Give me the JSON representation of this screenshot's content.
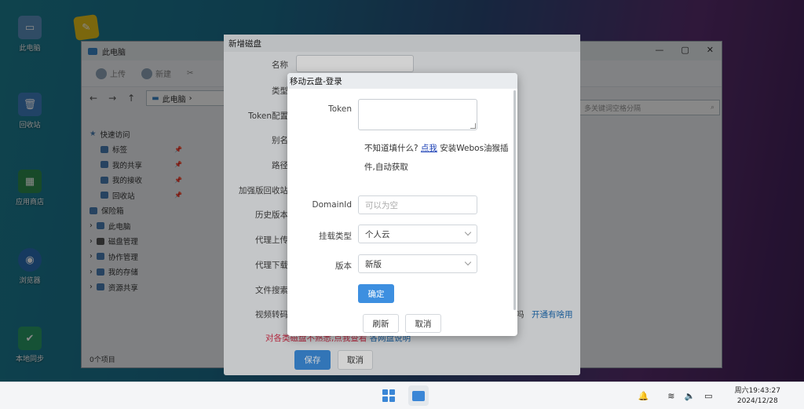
{
  "desktop": {
    "icons": [
      {
        "label": "此电脑"
      },
      {
        "label": "回收站"
      },
      {
        "label": "应用商店"
      },
      {
        "label": "浏览器"
      },
      {
        "label": "本地同步"
      }
    ]
  },
  "explorer": {
    "title": "此电脑",
    "toolbar": {
      "upload": "上传",
      "new": "新建"
    },
    "breadcrumb": "此电脑",
    "search_placeholder": "多关键词空格分隔",
    "sidebar": [
      {
        "label": "快速访问"
      },
      {
        "label": "标签"
      },
      {
        "label": "我的共享"
      },
      {
        "label": "我的接收"
      },
      {
        "label": "回收站"
      },
      {
        "label": "保险箱"
      },
      {
        "label": "此电脑"
      },
      {
        "label": "磁盘管理"
      },
      {
        "label": "协作管理"
      },
      {
        "label": "我的存储"
      },
      {
        "label": "资源共享"
      }
    ],
    "status": "0个项目"
  },
  "newdisk": {
    "title": "新增磁盘",
    "fields": {
      "name": "名称",
      "type": "类型",
      "token": "Token配置",
      "alias": "别名",
      "path": "路径",
      "recycle": "加强版回收站",
      "history": "历史版本",
      "proxy_upload": "代理上传",
      "proxy_download": "代理下载",
      "file_search": "文件搜索",
      "video": "视频转码"
    },
    "right_link": "开通有啥用",
    "right_text": "吗",
    "warning": "对各类磁盘不熟悉,点我查看",
    "warning_link": "各网盘说明",
    "save": "保存",
    "cancel": "取消"
  },
  "login": {
    "title": "移动云盘-登录",
    "token_label": "Token",
    "hint_prefix": "不知道填什么?",
    "hint_link": "点我",
    "hint_suffix": " 安装Webos油猴插件,自动获取",
    "domain_label": "DomainId",
    "domain_placeholder": "可以为空",
    "mount_label": "挂载类型",
    "mount_value": "个人云",
    "version_label": "版本",
    "version_value": "新版",
    "confirm": "确定",
    "refresh": "刷新",
    "cancel": "取消"
  },
  "taskbar": {
    "time": "周六19:43:27",
    "date": "2024/12/28"
  }
}
